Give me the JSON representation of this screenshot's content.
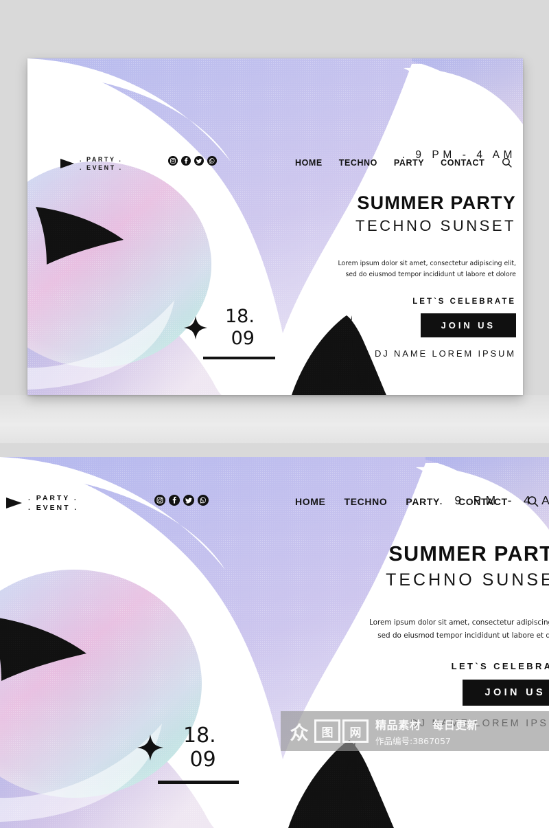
{
  "page": {
    "background_color": "#d9d9d9",
    "card_background": "#ffffff"
  },
  "brand": {
    "line1": ". PARTY .",
    "line2": ". EVENT .",
    "arrow_icon": "play-triangle-icon"
  },
  "social": [
    {
      "name": "instagram-icon",
      "label": "Instagram"
    },
    {
      "name": "facebook-icon",
      "label": "Facebook"
    },
    {
      "name": "twitter-icon",
      "label": "Twitter"
    },
    {
      "name": "whatsapp-icon",
      "label": "WhatsApp"
    }
  ],
  "nav": {
    "items": [
      {
        "label": "HOME"
      },
      {
        "label": "TECHNO"
      },
      {
        "label": "PARTY"
      },
      {
        "label": "CONTACT"
      }
    ],
    "search_icon": "search-icon"
  },
  "hero": {
    "time": ". 9 PM - 4 AM",
    "title": "SUMMER PARTY",
    "subtitle": "TECHNO SUNSET",
    "paragraph_line1": "Lorem ipsum dolor sit amet, consectetur adipiscing elit,",
    "paragraph_line2": "sed do eiusmod tempor incididunt ut labore et dolore",
    "celebrate": "LET`S CELEBRATE",
    "cta_label": "JOIN US",
    "dj": "DJ NAME LOREM IPSUM"
  },
  "date": {
    "day": "18.",
    "month": "09",
    "star_icon": "four-point-star-icon"
  },
  "colors": {
    "accent_periwinkle": "#b9bced",
    "accent_lilac": "#cfc2e8",
    "accent_pink": "#e6b9dd",
    "accent_mint": "#b7e4dd",
    "accent_blue": "#c3d6f2",
    "ink": "#111111",
    "cta_bg": "#101010",
    "cta_text": "#ffffff"
  },
  "watermark": {
    "glyph1": "众",
    "glyph2": "图",
    "glyph3": "网",
    "tagline": "精品素材　每日更新",
    "item_id": "作品编号:3867057"
  }
}
